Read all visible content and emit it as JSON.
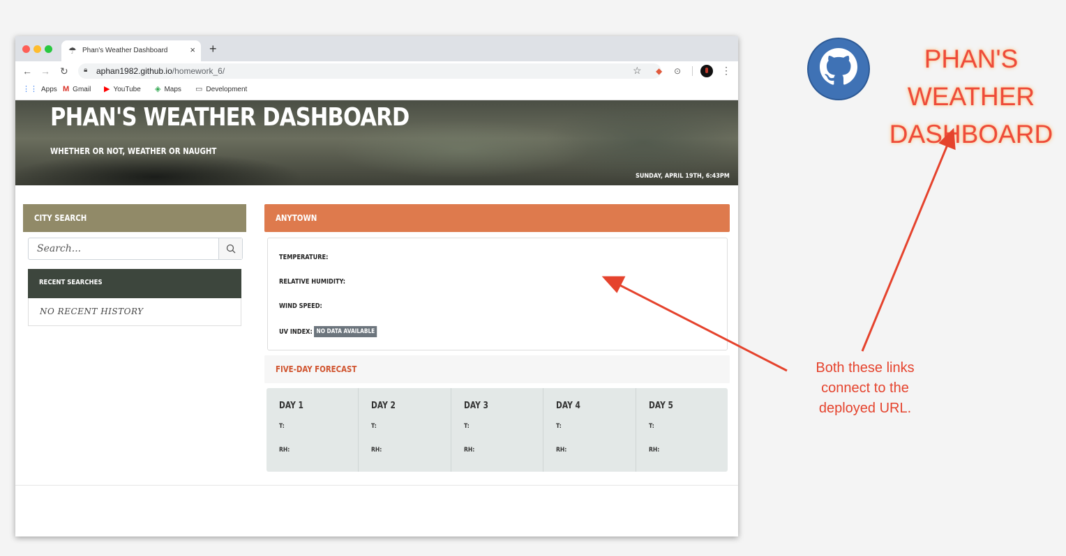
{
  "browser": {
    "tab_title": "Phan's Weather Dashboard",
    "tab_close": "×",
    "new_tab": "+",
    "url_host": "aphan1982.github.io",
    "url_path": "/homework_6/",
    "bookmarks": [
      "Apps",
      "Gmail",
      "YouTube",
      "Maps",
      "Development"
    ]
  },
  "header": {
    "title": "PHAN'S WEATHER DASHBOARD",
    "subtitle": "WHETHER OR NOT, WEATHER OR NAUGHT",
    "datetime": "SUNDAY, APRIL 19TH, 6:43PM"
  },
  "sidebar": {
    "city_search_title": "CITY SEARCH",
    "search_placeholder": "Search...",
    "recent_title": "RECENT SEARCHES",
    "recent_empty": "NO RECENT HISTORY"
  },
  "current": {
    "city": "ANYTOWN",
    "temperature_label": "TEMPERATURE:",
    "humidity_label": "RELATIVE HUMIDITY:",
    "wind_label": "WIND SPEED:",
    "uv_label": "UV INDEX:",
    "uv_value": "NO DATA AVAILABLE"
  },
  "forecast": {
    "title": "FIVE-DAY FORECAST",
    "days": [
      {
        "name": "DAY 1",
        "t": "T:",
        "rh": "RH:"
      },
      {
        "name": "DAY 2",
        "t": "T:",
        "rh": "RH:"
      },
      {
        "name": "DAY 3",
        "t": "T:",
        "rh": "RH:"
      },
      {
        "name": "DAY 4",
        "t": "T:",
        "rh": "RH:"
      },
      {
        "name": "DAY 5",
        "t": "T:",
        "rh": "RH:"
      }
    ]
  },
  "annotation": {
    "title_line1": "PHAN'S",
    "title_line2": "WEATHER",
    "title_line3": "DASHBOARD",
    "note": "Both these links connect to the deployed URL."
  },
  "colors": {
    "city_search_header": "#918a68",
    "recent_header": "#3d463d",
    "town_header": "#de7a4d",
    "forecast_title": "#d0542f",
    "annotation_red": "#e5432d"
  }
}
